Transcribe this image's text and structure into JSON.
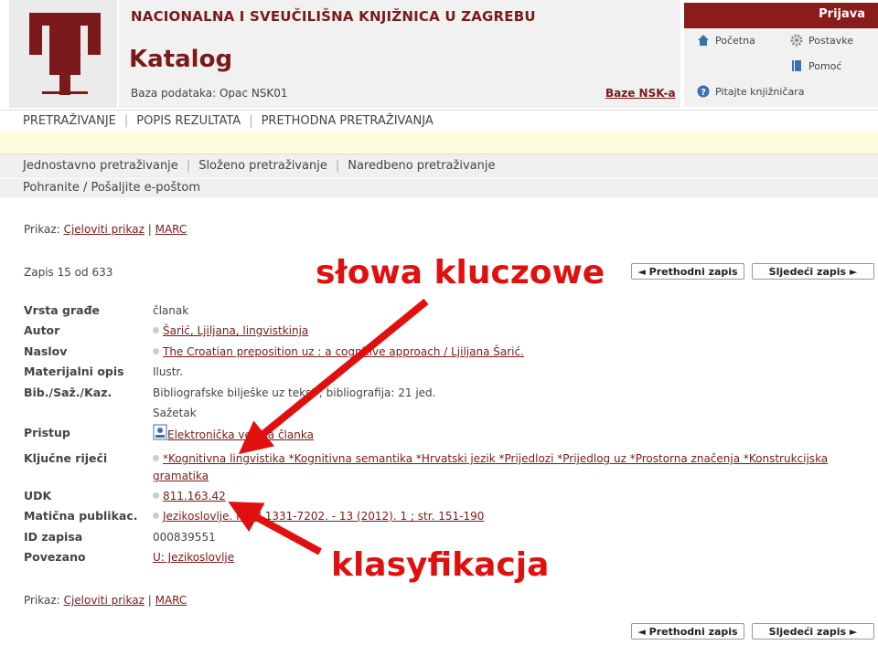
{
  "header": {
    "library_name": "NACIONALNA I SVEUČILIŠNA KNJIŽNICA U ZAGREBU",
    "catalog_title": "Katalog",
    "database_line": "Baza podataka: Opac NSK01",
    "databases_link": "Baze NSK-a",
    "login": "Prijava",
    "links": {
      "home": "Početna",
      "settings": "Postavke",
      "help": "Pomoć",
      "ask": "Pitajte knjižničara"
    }
  },
  "nav_main": [
    "PRETRAŽIVANJE",
    "POPIS REZULTATA",
    "PRETHODNA PRETRAŽIVANJA"
  ],
  "nav_search": [
    "Jednostavno pretraživanje",
    "Složeno pretraživanje",
    "Naredbeno pretraživanje"
  ],
  "nav_actions": "Pohranite / Pošaljite e-poštom",
  "view": {
    "label": "Prikaz:",
    "full": "Cjeloviti prikaz",
    "separator": "|",
    "marc": "MARC"
  },
  "record_position": "Zapis 15 od 633",
  "buttons": {
    "prev": "◄ Prethodni zapis",
    "next": "Sljedeći zapis ►"
  },
  "record": {
    "type_label": "Vrsta građe",
    "type": "članak",
    "author_label": "Autor",
    "author": "Šarić, Ljiljana, lingvistkinja",
    "title_label": "Naslov",
    "title": "The Croatian preposition uz : a cognitive approach / Ljiljana Šarić.",
    "physical_label": "Materijalni opis",
    "physical": "Ilustr.",
    "bib_label": "Bib./Saž./Kaz.",
    "bib": "Bibliografske bilješke uz tekst ; bibliografija: 21 jed.",
    "bib2": "Sažetak",
    "access_label": "Pristup",
    "access": "Elektronička verzija članka",
    "keywords_label": "Ključne riječi",
    "keywords_line1": "*Kognitivna lingvistika *Kognitivna semantika *Hrvatski jezik *Prijedlozi *Prijedlog uz *Prostorna značenja *Konstrukcijska",
    "keywords_line2": "gramatika",
    "udk_label": "UDK",
    "udk": "811.163.42",
    "parent_label": "Matična publikac.",
    "parent": "Jezikoslovlje. ISSN 1331-7202. - 13 (2012). 1 ; str. 151-190",
    "id_label": "ID zapisa",
    "id": "000839551",
    "related_label": "Povezano",
    "related": "U: Jezikoslovlje"
  },
  "annotations": {
    "keywords": "słowa kluczowe",
    "classification": "klasyfikacja",
    "color": "#e0100f"
  },
  "colors": {
    "brand": "#8b1c1c",
    "link": "#7a1a1a",
    "strip": "#fffde0"
  }
}
